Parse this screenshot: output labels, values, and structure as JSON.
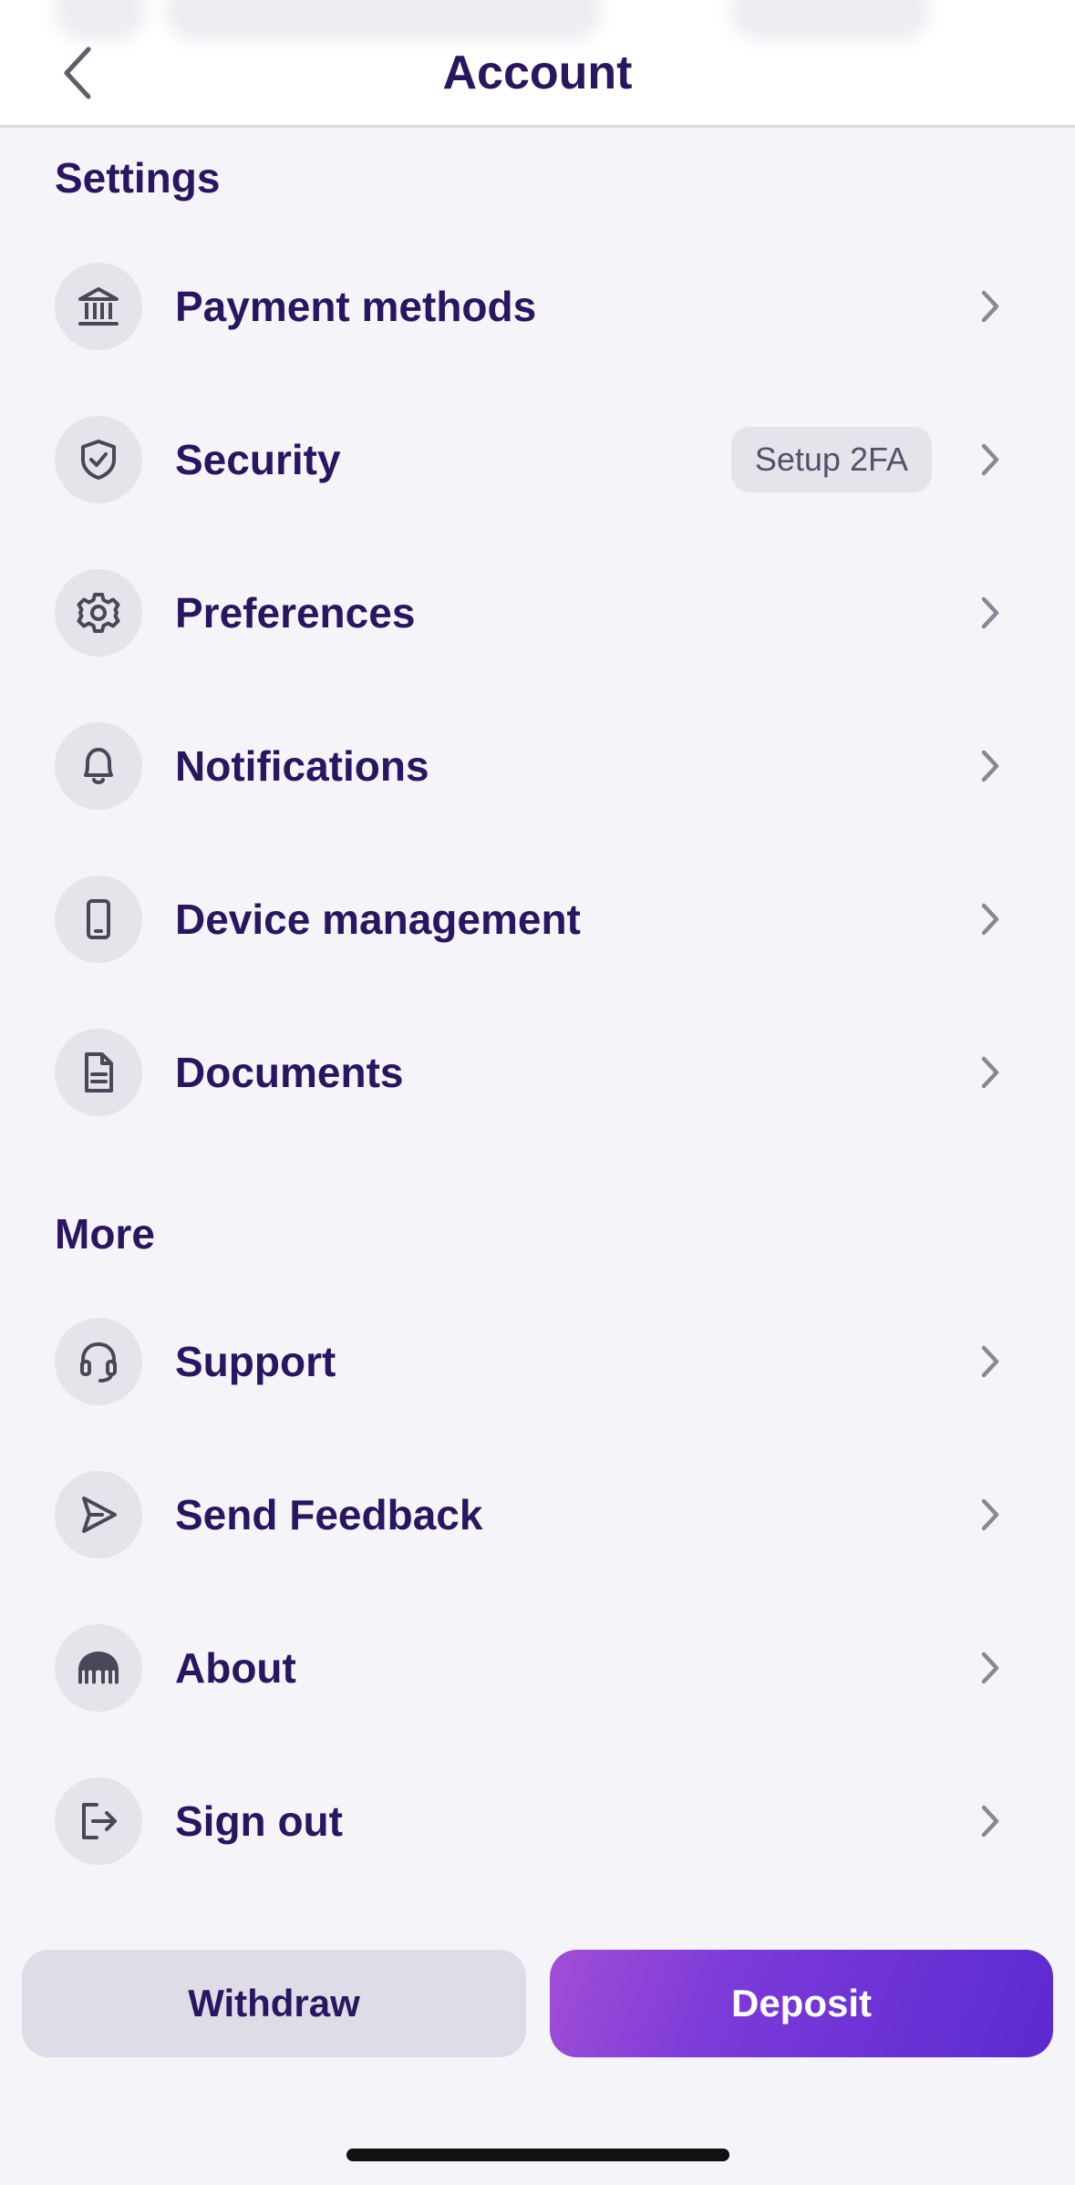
{
  "header": {
    "title": "Account"
  },
  "sections": {
    "settings": {
      "title": "Settings",
      "items": [
        {
          "label": "Payment methods",
          "icon": "bank-icon"
        },
        {
          "label": "Security",
          "icon": "shield-check-icon",
          "badge": "Setup 2FA"
        },
        {
          "label": "Preferences",
          "icon": "gear-icon"
        },
        {
          "label": "Notifications",
          "icon": "bell-icon"
        },
        {
          "label": "Device management",
          "icon": "phone-icon"
        },
        {
          "label": "Documents",
          "icon": "document-icon"
        }
      ]
    },
    "more": {
      "title": "More",
      "items": [
        {
          "label": "Support",
          "icon": "headset-icon"
        },
        {
          "label": "Send Feedback",
          "icon": "send-icon"
        },
        {
          "label": "About",
          "icon": "kraken-logo-icon"
        },
        {
          "label": "Sign out",
          "icon": "sign-out-icon"
        }
      ]
    }
  },
  "actions": {
    "withdraw": "Withdraw",
    "deposit": "Deposit"
  },
  "colors": {
    "text": "#2a1660",
    "accent": "#5a2ad0",
    "background": "#f5f4f9"
  }
}
